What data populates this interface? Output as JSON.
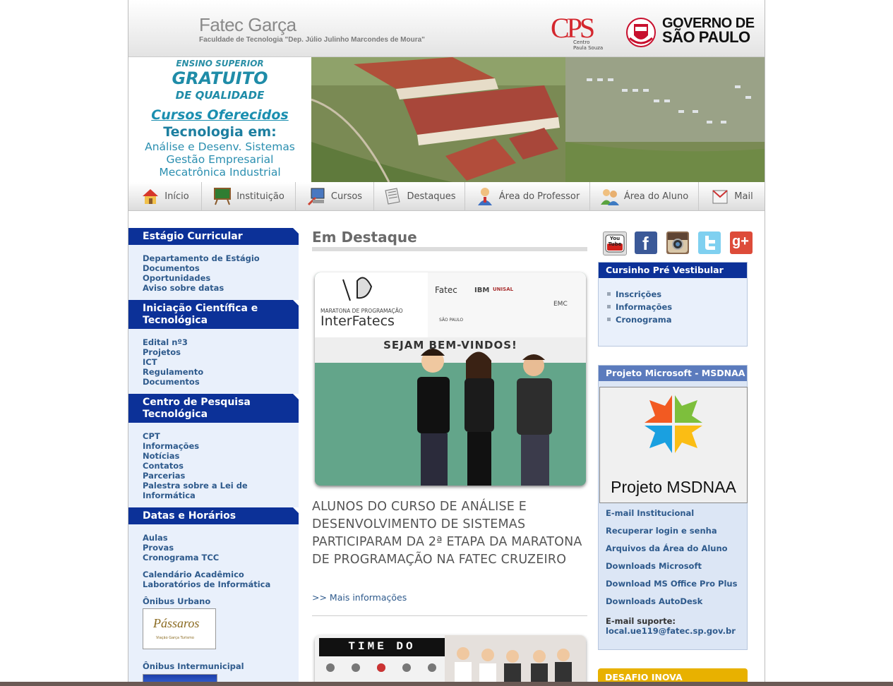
{
  "header": {
    "title": "Fatec Garça",
    "subtitle": "Faculdade de Tecnologia \"Dep. Júlio Julinho Marcondes de Moura\"",
    "cps_mark": "CPS",
    "cps_text": "Centro Paula Souza",
    "gov_line1": "GOVERNO DE",
    "gov_line2": "SÃO PAULO"
  },
  "banner": {
    "line1": "ENSINO SUPERIOR",
    "line2": "GRATUITO",
    "line3": "DE QUALIDADE",
    "courses_title": "Cursos Oferecidos",
    "tech_title": "Tecnologia em:",
    "course1": "Análise e Desenv. Sistemas",
    "course2": "Gestão Empresarial",
    "course3": "Mecatrônica Industrial"
  },
  "nav": [
    {
      "label": "Início",
      "icon": "house-icon"
    },
    {
      "label": "Instituição",
      "icon": "chalkboard-icon"
    },
    {
      "label": "Cursos",
      "icon": "computer-icon"
    },
    {
      "label": "Destaques",
      "icon": "newspaper-icon"
    },
    {
      "label": "Área do Professor",
      "icon": "professor-icon"
    },
    {
      "label": "Área do Aluno",
      "icon": "students-icon"
    },
    {
      "label": "Mail",
      "icon": "mail-icon"
    }
  ],
  "left_sidebar": {
    "estagio": {
      "title": "Estágio Curricular",
      "links": [
        "Departamento de Estágio",
        "Documentos",
        "Oportunidades",
        "Aviso sobre datas"
      ]
    },
    "iniciacao": {
      "title_line1": "Iniciação Científica e",
      "title_line2": "Tecnológica",
      "links": [
        "Edital nº3",
        "Projetos",
        "ICT",
        "Regulamento",
        "Documentos"
      ]
    },
    "pesquisa": {
      "title_line1": "Centro de Pesquisa",
      "title_line2": "Tecnológica",
      "links": [
        "CPT",
        "Informações",
        "Notícias",
        "Contatos",
        "Parcerias",
        "Palestra sobre a Lei de",
        "Informática"
      ]
    },
    "datas": {
      "title": "Datas e Horários",
      "links": [
        "Aulas",
        "Provas",
        "Cronograma TCC",
        "Calendário Acadêmico",
        "Laboratórios de Informática",
        "Ônibus Urbano",
        "Ônibus Intermunicipal"
      ]
    },
    "bus_logo_text": "Pássaros",
    "bus_logo_sub": "Viação Garça Turismo"
  },
  "center": {
    "title": "Em Destaque",
    "feature": {
      "event_line1": "MARATONA DE PROGRAMAÇÃO",
      "event_name": "InterFatecs",
      "welcome": "SEJAM BEM-VINDOS!",
      "sponsor_fatec": "Fatec",
      "sponsor_ibm": "IBM",
      "sponsor_unisal": "UNISAL",
      "sponsor_emc": "EMC",
      "sponsor_sp": "SÃO PAULO"
    },
    "news_title": "ALUNOS DO CURSO DE ANÁLISE E DESENVOLVIMENTO DE SISTEMAS PARTICIPARAM DA 2ª ETAPA DA MARATONA DE PROGRAMAÇÃO NA FATEC CRUZEIRO",
    "more_link": ">> Mais informações",
    "second_banner": "TIME DO"
  },
  "right_sidebar": {
    "social": [
      {
        "name": "YouTube",
        "icon": "youtube-icon",
        "label": "You Tube"
      },
      {
        "name": "Facebook",
        "icon": "facebook-icon",
        "label": "f"
      },
      {
        "name": "Instagram",
        "icon": "instagram-icon",
        "label": ""
      },
      {
        "name": "Twitter",
        "icon": "twitter-icon",
        "label": ""
      },
      {
        "name": "Google+",
        "icon": "googleplus-icon",
        "label": "g+"
      }
    ],
    "cursinho": {
      "title": "Cursinho Pré Vestibular",
      "links": [
        "Inscrições",
        "Informações",
        "Cronograma"
      ]
    },
    "microsoft": {
      "title": "Projeto Microsoft - MSDNAA",
      "image_label": "Projeto MSDNAA",
      "links": [
        "E-mail Institucional",
        "Recuperar login e senha",
        "Arquivos da Área do Aluno",
        "Downloads Microsoft",
        "Download MS Office Pro Plus",
        "Downloads AutoDesk"
      ],
      "support_label": "E-mail suporte:",
      "support_email": "local.ue119@fatec.sp.gov.br"
    },
    "desafio": {
      "title": "DESAFIO INOVA"
    }
  },
  "colors": {
    "nav_blue": "#0c3198",
    "link": "#2e5a8c",
    "sidebar_bg": "#e9f0fb",
    "desafio": "#e8b100"
  }
}
